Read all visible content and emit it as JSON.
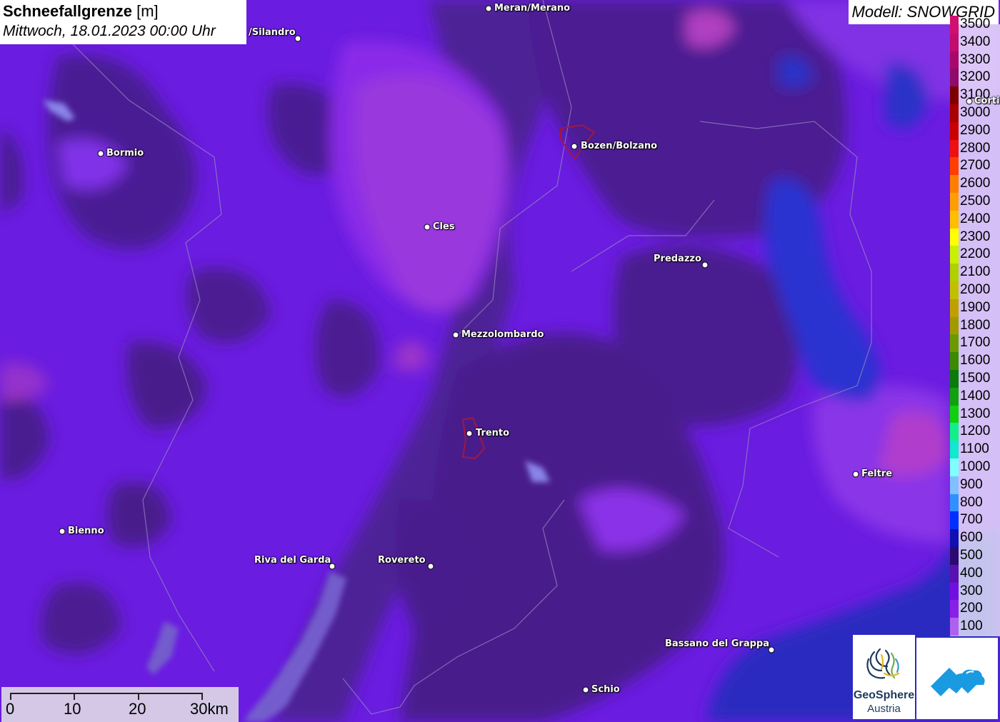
{
  "title": {
    "main": "Schneefallgrenze",
    "unit": "[m]",
    "datetime": "Mittwoch, 18.01.2023 00:00 Uhr"
  },
  "model": "Modell: SNOWGRID",
  "legend": [
    {
      "value": "3500",
      "color": "#d10f6f"
    },
    {
      "value": "3400",
      "color": "#c20c6e"
    },
    {
      "value": "3300",
      "color": "#a8086a"
    },
    {
      "value": "3200",
      "color": "#8f0a6a"
    },
    {
      "value": "3100",
      "color": "#7d0000"
    },
    {
      "value": "3000",
      "color": "#a80000"
    },
    {
      "value": "2900",
      "color": "#c80000"
    },
    {
      "value": "2800",
      "color": "#ee1010"
    },
    {
      "value": "2700",
      "color": "#ff3e00"
    },
    {
      "value": "2600",
      "color": "#ff7e00"
    },
    {
      "value": "2500",
      "color": "#ff9e00"
    },
    {
      "value": "2400",
      "color": "#ffbe00"
    },
    {
      "value": "2300",
      "color": "#ffff00"
    },
    {
      "value": "2200",
      "color": "#c8f000"
    },
    {
      "value": "2100",
      "color": "#b0d000"
    },
    {
      "value": "2000",
      "color": "#c0c000"
    },
    {
      "value": "1900",
      "color": "#c0a000"
    },
    {
      "value": "1800",
      "color": "#a09a00"
    },
    {
      "value": "1700",
      "color": "#6a9a00"
    },
    {
      "value": "1600",
      "color": "#3a8a00"
    },
    {
      "value": "1500",
      "color": "#0a7a0a"
    },
    {
      "value": "1400",
      "color": "#10a010"
    },
    {
      "value": "1300",
      "color": "#10d010"
    },
    {
      "value": "1200",
      "color": "#10f08a"
    },
    {
      "value": "1100",
      "color": "#10e8d0"
    },
    {
      "value": "1000",
      "color": "#80ffff"
    },
    {
      "value": "900",
      "color": "#80c0ff"
    },
    {
      "value": "800",
      "color": "#3090ff"
    },
    {
      "value": "700",
      "color": "#0030ff"
    },
    {
      "value": "600",
      "color": "#1010b0"
    },
    {
      "value": "500",
      "color": "#2a0a70"
    },
    {
      "value": "400",
      "color": "#5a10b0"
    },
    {
      "value": "300",
      "color": "#7010e0"
    },
    {
      "value": "200",
      "color": "#8a20e8"
    },
    {
      "value": "100",
      "color": "#b060f0"
    }
  ],
  "cities": [
    {
      "name": "Meran/Merano"
    },
    {
      "name": "/Silandro"
    },
    {
      "name": "Bormio"
    },
    {
      "name": "Bozen/Bolzano"
    },
    {
      "name": "Cles"
    },
    {
      "name": "Predazzo"
    },
    {
      "name": "Mezzolombardo"
    },
    {
      "name": "Trento"
    },
    {
      "name": "Feltre"
    },
    {
      "name": "Bienno"
    },
    {
      "name": "Riva del Garda"
    },
    {
      "name": "Rovereto"
    },
    {
      "name": "Bassano del Grappa"
    },
    {
      "name": "Schio"
    },
    {
      "name": "Corti"
    }
  ],
  "scale": {
    "labels": [
      "0",
      "10",
      "20",
      "30km"
    ]
  },
  "logos": {
    "geosphere_line1": "GeoSphere",
    "geosphere_line2": "Austria"
  }
}
